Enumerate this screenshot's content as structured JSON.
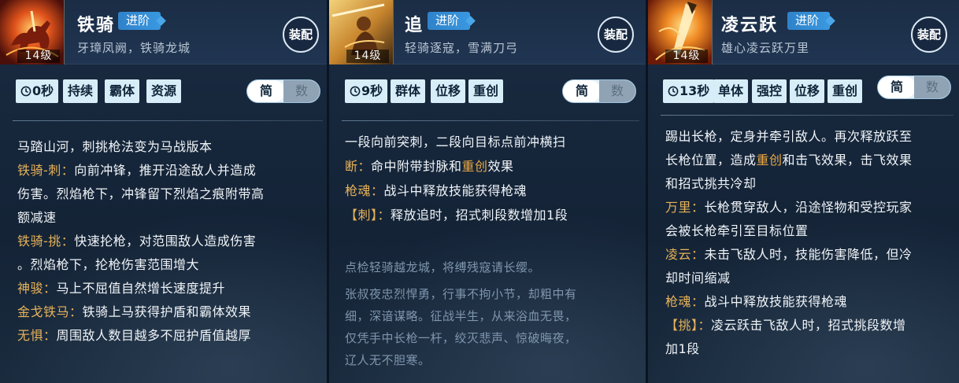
{
  "panels": [
    {
      "level": "14级",
      "name": "铁骑",
      "advance": "进阶",
      "subtitle": "牙璋凤阙，铁骑龙城",
      "equip": "装配",
      "tags": [
        "0秒",
        "持续",
        "霸体",
        "资源"
      ],
      "toggle": {
        "on": "简",
        "off": "数"
      },
      "lines": [
        {
          "text": "马踏山河，刺挑枪法变为马战版本"
        },
        {
          "kw": "铁骑-刺：",
          "text": "向前冲锋，推开沿途敌人并造成"
        },
        {
          "text": "伤害。烈焰枪下，冲锋留下烈焰之痕附带高"
        },
        {
          "text": "额减速"
        },
        {
          "kw": "铁骑-挑：",
          "text": "快速抡枪，对范围敌人造成伤害"
        },
        {
          "text": "。烈焰枪下，抡枪伤害范围增大"
        },
        {
          "kw": "神骏：",
          "text": "马上不屈值自然增长速度提升"
        },
        {
          "kw": "金戈铁马：",
          "text": "铁骑上马获得护盾和霸体效果"
        },
        {
          "kw": "无惧：",
          "text": "周围敌人数目越多不屈护盾值越厚"
        }
      ]
    },
    {
      "level": "14级",
      "name": "追",
      "advance": "进阶",
      "subtitle": "轻骑逐寇，雪满刀弓",
      "equip": "装配",
      "tags": [
        "9秒",
        "群体",
        "位移",
        "重创"
      ],
      "toggle": {
        "on": "简",
        "off": "数"
      },
      "lines": [
        {
          "text": "一段向前突刺，二段向目标点前冲横扫"
        },
        {
          "kw": "断：",
          "pre": "命中附带封脉和",
          "hl": "重创",
          "post": "效果"
        },
        {
          "kw": "枪魂：",
          "text": "战斗中释放技能获得枪魂"
        },
        {
          "kw": "【刺】：",
          "text": "释放追时，招式刺段数增加1段"
        }
      ],
      "lore": [
        "点检轻骑越龙城，将缚残寇请长缨。",
        "张叔夜忠烈悍勇，行事不拘小节，却粗中有",
        "细，深谙谋略。征战半生，从来浴血无畏，",
        "仅凭手中长枪一杆，绞灭悲声、惊破晦夜，",
        "辽人无不胆寒。"
      ]
    },
    {
      "level": "14级",
      "name": "凌云跃",
      "advance": "进阶",
      "subtitle": "雄心凌云跃万里",
      "equip": "装配",
      "tags": [
        "13秒",
        "单体",
        "强控",
        "位移",
        "重创"
      ],
      "toggle": {
        "on": "简",
        "off": "数"
      },
      "lines": [
        {
          "text": "踢出长枪，定身并牵引敌人。再次释放跃至"
        },
        {
          "pre": "长枪位置，造成",
          "hl": "重创",
          "post": "和击飞效果，击飞效果"
        },
        {
          "text": "和招式挑共冷却"
        },
        {
          "kw": "万里：",
          "text": "长枪贯穿敌人，沿途怪物和受控玩家"
        },
        {
          "text": "会被长枪牵引至目标位置"
        },
        {
          "kw": "凌云：",
          "text": "未击飞敌人时，技能伤害降低，但冷"
        },
        {
          "text": "却时间缩减"
        },
        {
          "kw": "枪魂：",
          "text": "战斗中释放技能获得枪魂"
        },
        {
          "kw": "【挑】：",
          "text": "凌云跃击飞敌人时，招式挑段数增"
        },
        {
          "text": "加1段"
        }
      ]
    }
  ],
  "colors": {
    "keyword": "#e7b25a",
    "highlight": "#e9a743",
    "tag_bg": "#d7eef9",
    "advance_bg": "#3a98e0"
  },
  "icons": [
    "cooldown-clock-icon"
  ]
}
